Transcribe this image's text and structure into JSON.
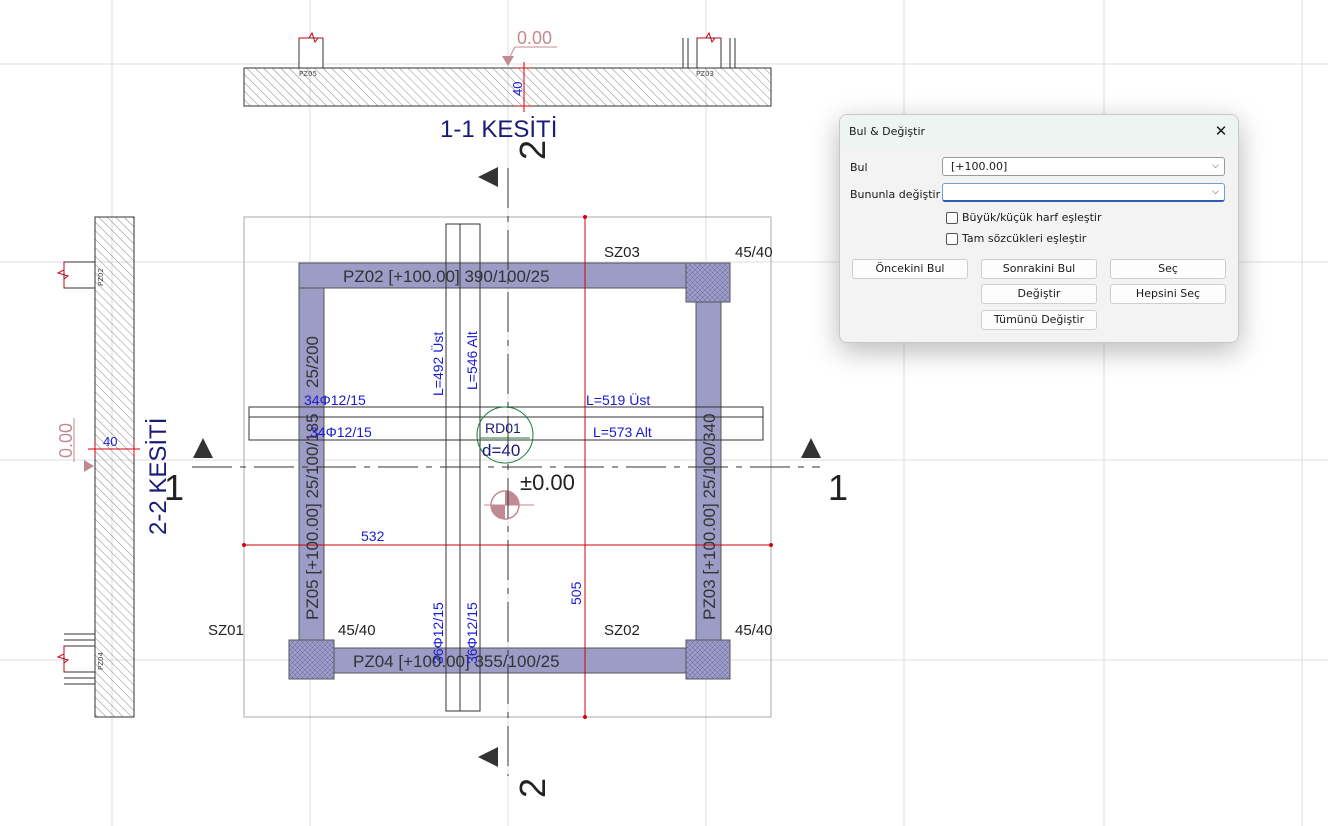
{
  "drawing": {
    "section_1_title": "1-1 KESİTİ",
    "section_2_title": "2-2 KESİTİ",
    "elev_top": "0.00",
    "elev_left": "0.00",
    "dim_top_thk": "40",
    "dim_left_thk": "40",
    "cut_mark_1": "1",
    "cut_mark_2": "2",
    "tag_pz05_sec": "PZ05",
    "tag_pz03_sec": "PZ03",
    "tag_pz02_sec": "PZ02",
    "tag_pz04_sec": "PZ04",
    "beam_top": "PZ02 [+100.00]   390/100/25",
    "beam_bottom": "PZ04 [+100.00]   355/100/25",
    "beam_left": "PZ05 [+100.00]   25/100/185",
    "beam_left_overlap": "25/200",
    "beam_right": "PZ03 [+100.00]   25/100/340",
    "col_sz01": "SZ01",
    "col_sz02": "SZ02",
    "col_sz03": "SZ03",
    "col_size_tr": "45/40",
    "col_size_bl": "45/40",
    "col_size_br": "45/40",
    "rebar_h1": "34Φ12/15",
    "rebar_h2": "34Φ12/15",
    "rebar_v1": "36Φ12/15",
    "rebar_v2": "36Φ12/15",
    "len_519": "L=519 Üst",
    "len_573": "L=573 Alt",
    "len_492": "L=492 Üst",
    "len_546": "L=546 Alt",
    "slab_id": "RD01",
    "slab_thk": "d=40",
    "elev_slab": "±0.00",
    "dim_532": "532",
    "dim_505": "505"
  },
  "dialog": {
    "title": "Bul & Değiştir",
    "find_label": "Bul",
    "find_value": "[+100.00]",
    "replace_label": "Bununla değiştir :",
    "replace_value": "",
    "match_case_label": "Büyük/küçük harf eşleştir",
    "whole_word_label": "Tam sözcükleri eşleştir",
    "btn_prev": "Öncekini Bul",
    "btn_next": "Sonrakini Bul",
    "btn_select": "Seç",
    "btn_replace": "Değiştir",
    "btn_select_all": "Hepsini Seç",
    "btn_replace_all": "Tümünü Değiştir"
  },
  "colors": {
    "beam_fill": "#9c9cc6",
    "dim_red": "#d4000a",
    "rebar_blue": "#1a1ad4",
    "title_navy": "#1a1a78",
    "elev_pink": "#c08a95"
  }
}
